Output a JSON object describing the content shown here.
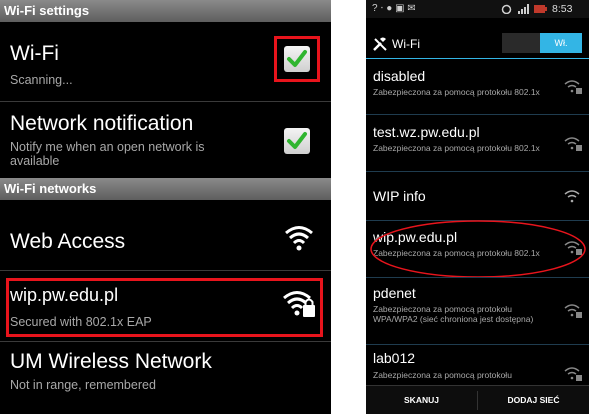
{
  "left": {
    "header_settings": "Wi-Fi settings",
    "wifi": {
      "title": "Wi-Fi",
      "subtitle": "Scanning..."
    },
    "notification": {
      "title": "Network notification",
      "subtitle": "Notify me when an open network is available"
    },
    "header_networks": "Wi-Fi networks",
    "networks": [
      {
        "name": "Web Access",
        "status": ""
      },
      {
        "name": "wip.pw.edu.pl",
        "status": "Secured with 802.1x EAP"
      },
      {
        "name": "UM Wireless Network",
        "status": "Not in range, remembered"
      }
    ],
    "highlight_color": "#e8141c",
    "check_color": "#2fb52f"
  },
  "right": {
    "status_bar": {
      "time": "8:53"
    },
    "toggle_label": "Wł.",
    "title": "Wi-Fi",
    "networks": [
      {
        "name": "disabled",
        "status": "Zabezpieczona za pomocą protokołu 802.1x"
      },
      {
        "name": "test.wz.pw.edu.pl",
        "status": "Zabezpieczona za pomocą protokołu 802.1x"
      },
      {
        "name": "WIP info",
        "status": ""
      },
      {
        "name": "wip.pw.edu.pl",
        "status": "Zabezpieczona za pomocą protokołu 802.1x"
      },
      {
        "name": "pdenet",
        "status": "Zabezpieczona za pomocą protokołu WPA/WPA2 (sieć chroniona jest dostępna)"
      },
      {
        "name": "lab012",
        "status": "Zabezpieczona za pomocą protokołu"
      }
    ],
    "buttons": {
      "scan": "SKANUJ",
      "add": "DODAJ SIEĆ"
    },
    "accent_color": "#33b5e5"
  }
}
